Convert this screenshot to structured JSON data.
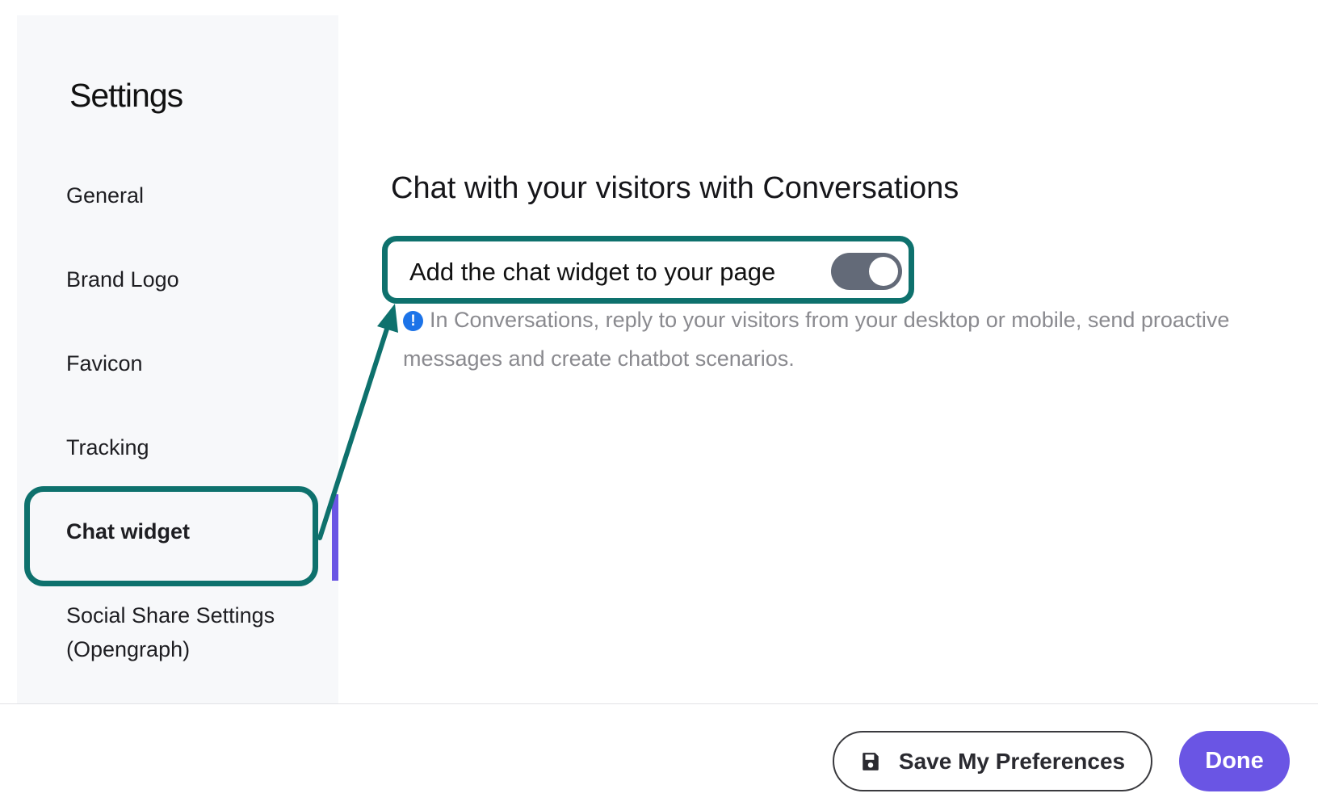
{
  "sidebar": {
    "title": "Settings",
    "items": [
      {
        "label": "General"
      },
      {
        "label": "Brand Logo"
      },
      {
        "label": "Favicon"
      },
      {
        "label": "Tracking"
      },
      {
        "label": "Chat widget",
        "active": true
      },
      {
        "label": "Social Share Settings"
      },
      {
        "label": "(Opengraph)"
      }
    ]
  },
  "main": {
    "heading": "Chat with your visitors with Conversations",
    "toggle": {
      "label": "Add the chat widget to your page",
      "state": "on"
    },
    "info": {
      "icon": "info-icon",
      "text": "In Conversations, reply to your visitors from your desktop or mobile, send proactive messages and create chatbot scenarios."
    }
  },
  "footer": {
    "save_label": "Save My Preferences",
    "save_icon": "floppy-disk-icon",
    "done_label": "Done"
  },
  "colors": {
    "accent": "#6a55e4",
    "annotation": "#0e716d",
    "toggle_on": "#636a78",
    "info_blue": "#1c73e8"
  }
}
